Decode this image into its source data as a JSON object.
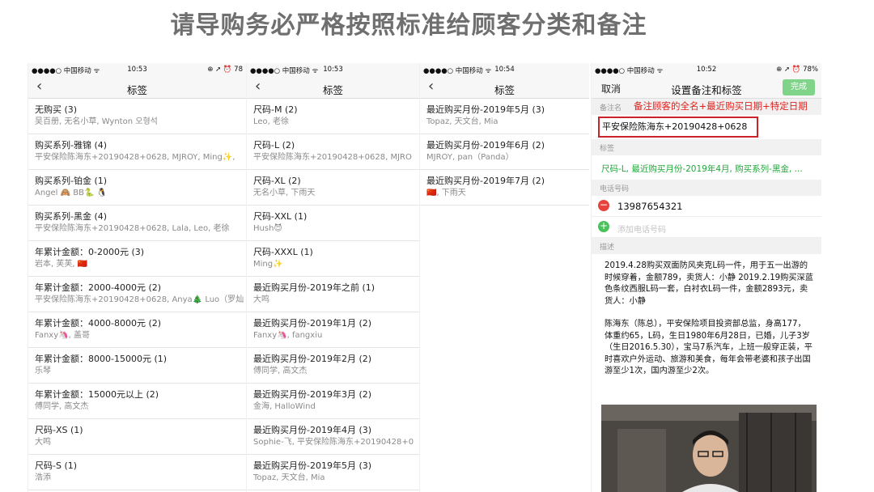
{
  "headline": "请导购务必严格按照标准给顾客分类和备注",
  "status": {
    "carrier": "●●●●○ 中国移动 ᯤ",
    "p1_time": "10:53",
    "p1_right": "⊕ ➚ ⏰ 78",
    "p2_time": "10:53",
    "p3_time": "10:54",
    "p4_time": "10:52",
    "p4_right": "⊕ ➚ ⏰ 78%"
  },
  "nav": {
    "back": "‹",
    "title": "标签"
  },
  "phone1": [
    {
      "name": "无购买 (3)",
      "members": "吴百册, 无名小草, Wynton 오형석"
    },
    {
      "name": "购买系列-雅锦 (4)",
      "members": "平安保险陈海东+20190428+0628, MJROY, Ming✨,"
    },
    {
      "name": "购买系列-铂金 (1)",
      "members": "Angel 🙈 BB🐍 🐧"
    },
    {
      "name": "购买系列-黑金 (4)",
      "members": "平安保险陈海东+20190428+0628, Lala, Leo, 老徐"
    },
    {
      "name": "年累计金额：0-2000元 (3)",
      "members": "岩本, 芙芙, 🇨🇳"
    },
    {
      "name": "年累计金额：2000-4000元 (2)",
      "members": "平安保险陈海东+20190428+0628, Anya🎄 Luo（罗灿"
    },
    {
      "name": "年累计金额：4000-8000元 (2)",
      "members": "Fanxy🦄, 盖哥"
    },
    {
      "name": "年累计金额：8000-15000元 (1)",
      "members": "乐琴"
    },
    {
      "name": "年累计金额：15000元以上 (2)",
      "members": "傅同学, 高文杰"
    },
    {
      "name": "尺码-XS (1)",
      "members": "大鸣"
    },
    {
      "name": "尺码-S (1)",
      "members": "浩添"
    }
  ],
  "phone2": [
    {
      "name": "尺码-M (2)",
      "members": "Leo, 老徐"
    },
    {
      "name": "尺码-L (2)",
      "members": "平安保险陈海东+20190428+0628, MJRO"
    },
    {
      "name": "尺码-XL (2)",
      "members": "无名小草, 下雨天"
    },
    {
      "name": "尺码-XXL (1)",
      "members": "Hush😈"
    },
    {
      "name": "尺码-XXXL (1)",
      "members": "Ming✨"
    },
    {
      "name": "最近购买月份-2019年之前 (1)",
      "members": "大鸣"
    },
    {
      "name": "最近购买月份-2019年1月 (2)",
      "members": "Fanxy🦄, fangxiu"
    },
    {
      "name": "最近购买月份-2019年2月 (2)",
      "members": "傅同学, 高文杰"
    },
    {
      "name": "最近购买月份-2019年3月 (2)",
      "members": "金海, HalloWind"
    },
    {
      "name": "最近购买月份-2019年4月 (3)",
      "members": "Sophie-飞, 平安保险陈海东+20190428+0"
    },
    {
      "name": "最近购买月份-2019年5月 (3)",
      "members": "Topaz, 天文台, Mia"
    }
  ],
  "phone3": [
    {
      "name": "最近购买月份-2019年5月 (3)",
      "members": "Topaz, 天文台, Mia"
    },
    {
      "name": "最近购买月份-2019年6月 (2)",
      "members": "MJROY, pan（Panda）"
    },
    {
      "name": "最近购买月份-2019年7月 (2)",
      "members": "🇨🇳, 下雨天"
    }
  ],
  "phone4": {
    "cancel": "取消",
    "title": "设置备注和标签",
    "done": "完成",
    "remark_label": "备注名",
    "remark_tip": "备注顾客的全名+最近购买日期+特定日期",
    "remark_value": "平安保险陈海东+20190428+0628",
    "tags_label": "标签",
    "tags_value": "尺码-L, 最近购买月份-2019年4月, 购买系列-黑金, ...",
    "phone_label": "电话号码",
    "phone_number": "13987654321",
    "add_phone": "添加电话号码",
    "desc_label": "描述",
    "desc_p1": "2019.4.28购买双面防风夹克L码一件，用于五一出游的时候穿着，金额789，卖货人：小静 2019.2.19购买深蓝色条纹西服L码一套，白衬衣L码一件，金额2893元，卖货人：小静",
    "desc_p2": "陈海东（陈总），平安保险项目投资部总监，身高177，体重约65，L码，生日1980年6月28日，已婚，儿子3岁（生日2016.5.30），宝马7系汽车，上班一般穿正装，平时喜欢户外运动、旅游和美食，每年会带老婆和孩子出国游至少1次，国内游至少2次。"
  },
  "colors": {
    "accent_red": "#e0221e",
    "tag_green": "#21a83a",
    "done_green": "#7fd48a"
  }
}
